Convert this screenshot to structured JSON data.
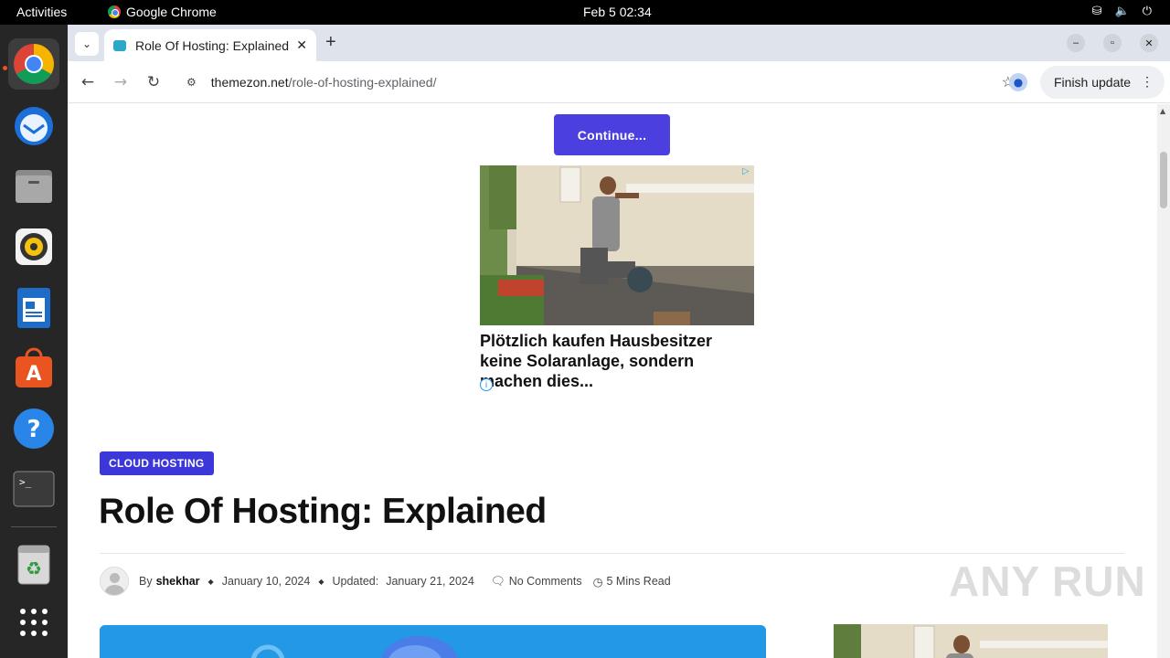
{
  "system": {
    "activities": "Activities",
    "app_name": "Google Chrome",
    "clock": "Feb 5  02:34"
  },
  "dock": {
    "items": [
      "chrome",
      "thunderbird",
      "files",
      "rhythmbox",
      "libreoffice-writer",
      "app-center",
      "help",
      "terminal",
      "trash",
      "show-apps"
    ]
  },
  "browser": {
    "tab_title": "Role Of Hosting: Explained",
    "url_domain": "themezon.net",
    "url_path": "/role-of-hosting-explained/",
    "finish_update": "Finish update"
  },
  "page": {
    "continue_label": "Continue...",
    "ad_headline": "Plötzlich kaufen Hausbesitzer keine Solaranlage, sondern machen dies...",
    "category": "CLOUD HOSTING",
    "title": "Role Of Hosting: Explained",
    "meta": {
      "by": "By",
      "author": "shekhar",
      "published": "January 10, 2024",
      "updated_label": "Updated:",
      "updated": "January 21, 2024",
      "comments": "No Comments",
      "read_time": "5 Mins Read"
    },
    "watermark": "ANY RUN"
  },
  "colors": {
    "accent": "#3b37d8",
    "button": "#4b3fe0",
    "hero": "#2399e6"
  }
}
